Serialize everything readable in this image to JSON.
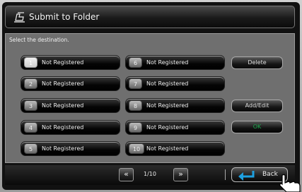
{
  "title": "Submit to Folder",
  "instruction": "Select the destination.",
  "slots": [
    {
      "number": "1",
      "label": "Not Registered"
    },
    {
      "number": "2",
      "label": "Not Registered"
    },
    {
      "number": "3",
      "label": "Not Registered"
    },
    {
      "number": "4",
      "label": "Not Registered"
    },
    {
      "number": "5",
      "label": "Not Registered"
    },
    {
      "number": "6",
      "label": "Not Registered"
    },
    {
      "number": "7",
      "label": "Not Registered"
    },
    {
      "number": "8",
      "label": "Not Registered"
    },
    {
      "number": "9",
      "label": "Not Registered"
    },
    {
      "number": "10",
      "label": "Not Registered"
    }
  ],
  "buttons": {
    "delete": "Delete",
    "add_edit": "Add/Edit",
    "ok": "OK",
    "back": "Back",
    "prev": "«",
    "next": "»"
  },
  "pagination": {
    "indicator": "1/10"
  },
  "colors": {
    "ok_text": "#1aa84c",
    "back_icon": "#1ea0e0"
  },
  "icons": {
    "title": "folder-edit-icon",
    "back": "return-arrow-icon",
    "cursor": "hand-pointer-icon"
  }
}
